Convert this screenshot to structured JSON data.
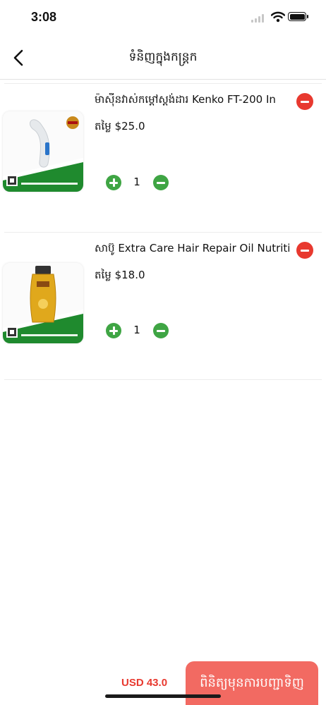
{
  "status_bar": {
    "time": "3:08"
  },
  "header": {
    "title": "ទំនិញក្នុងកន្ត្រក"
  },
  "cart": {
    "items": [
      {
        "name": "ម៉ាស៊ីនវាស់កម្ដៅស្តង់ដារ Kenko FT-200 In",
        "price": "តម្លៃ $25.0",
        "quantity": "1",
        "image_icon": "thermometer-product-image"
      },
      {
        "name": "សាប៊ូ Extra Care Hair Repair Oil Nutriti",
        "price": "តម្លៃ $18.0",
        "quantity": "1",
        "image_icon": "shampoo-bottle-product-image"
      }
    ]
  },
  "footer": {
    "total": "USD 43.0",
    "checkout_label": "ពិនិត្យមុនការបញ្ជាទិញ"
  },
  "colors": {
    "accent_red": "#e8392f",
    "checkout_bg": "#f26a62",
    "qty_green": "#3fa544"
  }
}
